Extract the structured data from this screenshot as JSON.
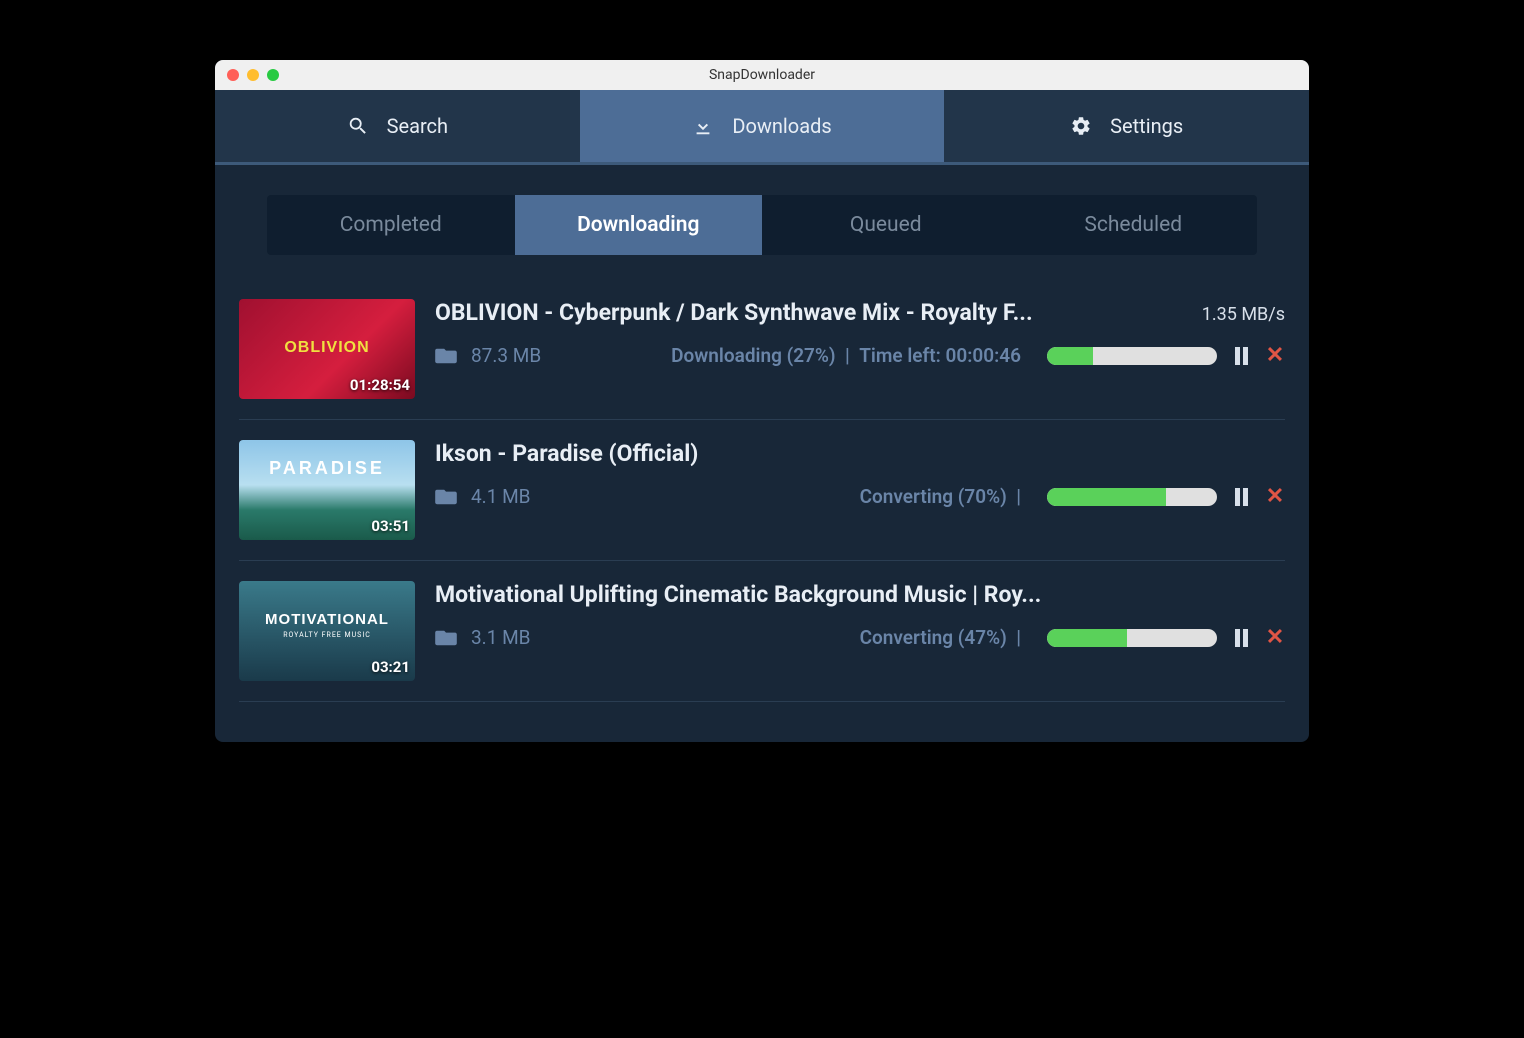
{
  "window": {
    "title": "SnapDownloader"
  },
  "nav": {
    "tabs": [
      {
        "label": "Search"
      },
      {
        "label": "Downloads"
      },
      {
        "label": "Settings"
      }
    ],
    "activeIndex": 1
  },
  "subtabs": {
    "items": [
      {
        "label": "Completed"
      },
      {
        "label": "Downloading"
      },
      {
        "label": "Queued"
      },
      {
        "label": "Scheduled"
      }
    ],
    "activeIndex": 1
  },
  "downloads": [
    {
      "title": "OBLIVION - Cyberpunk / Dark Synthwave Mix - Royalty F...",
      "duration": "01:28:54",
      "size": "87.3 MB",
      "status": "Downloading (27%)",
      "timeLeft": "Time left: 00:00:46",
      "speed": "1.35 MB/s",
      "progress": 27,
      "thumbText": "OBLIVION",
      "thumbSubText": ""
    },
    {
      "title": "Ikson - Paradise (Official)",
      "duration": "03:51",
      "size": "4.1 MB",
      "status": "Converting (70%)",
      "timeLeft": "",
      "speed": "",
      "progress": 70,
      "thumbText": "PARADISE",
      "thumbSubText": ""
    },
    {
      "title": "Motivational Uplifting Cinematic Background Music | Roy...",
      "duration": "03:21",
      "size": "3.1 MB",
      "status": "Converting (47%)",
      "timeLeft": "",
      "speed": "",
      "progress": 47,
      "thumbText": "MOTIVATIONAL",
      "thumbSubText": "ROYALTY FREE MUSIC"
    }
  ]
}
